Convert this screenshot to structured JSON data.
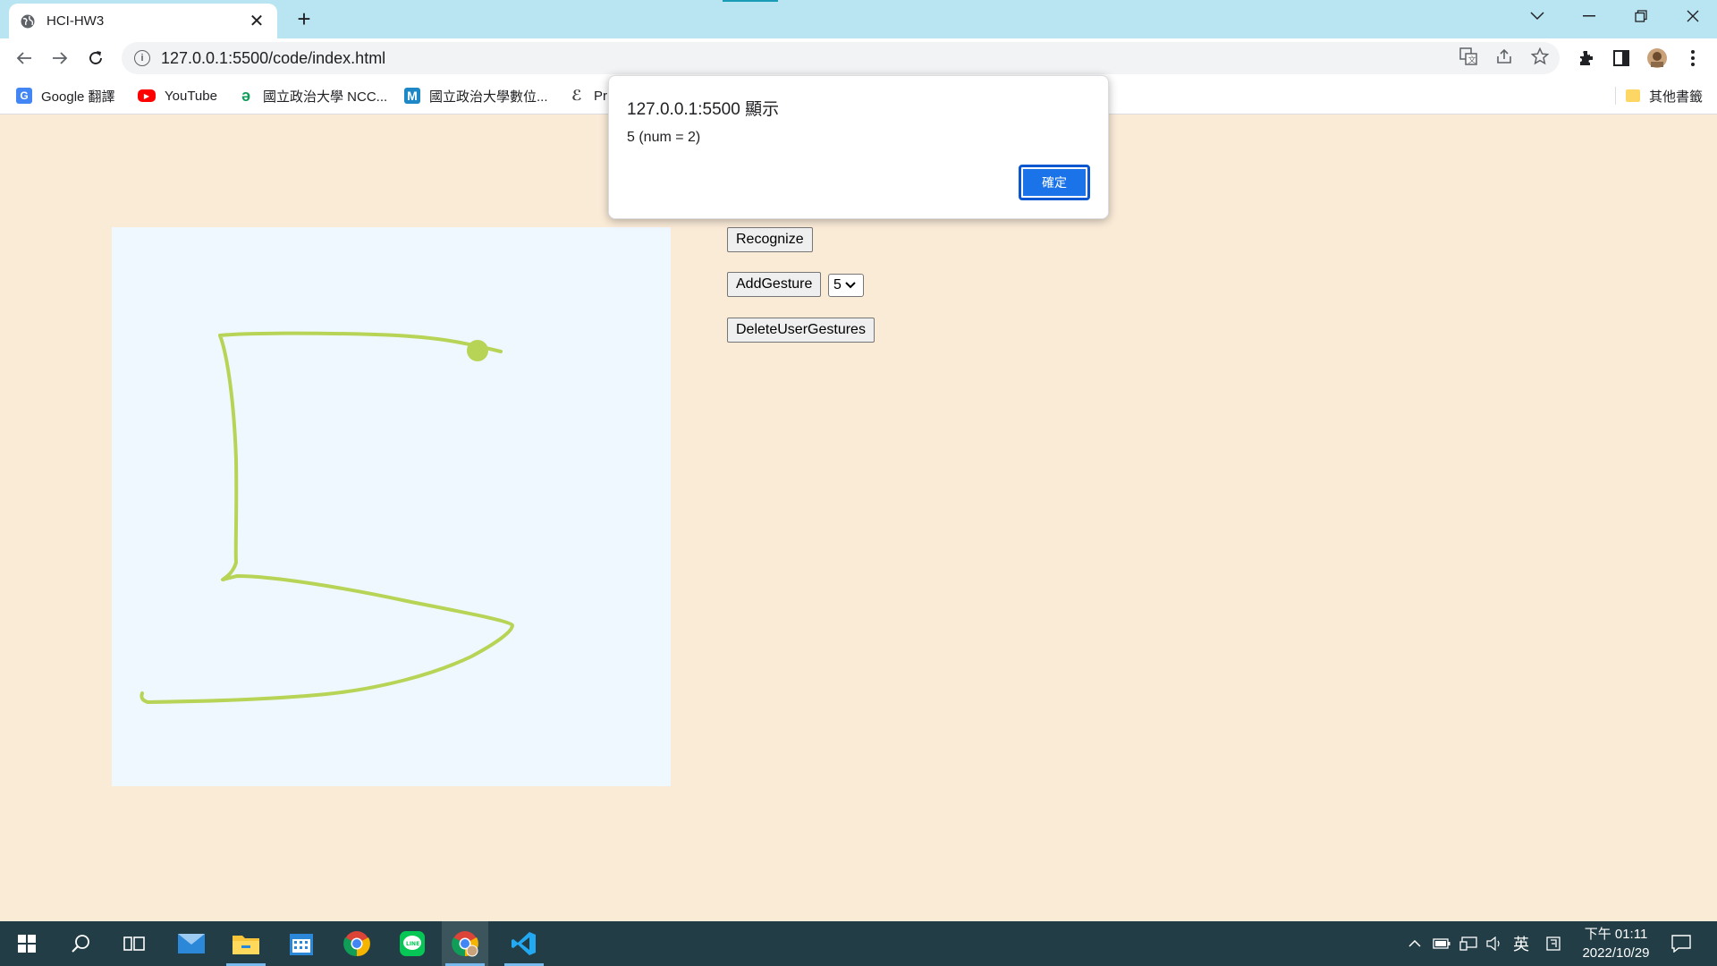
{
  "browser": {
    "tab_title": "HCI-HW3",
    "tab_close": "✕",
    "new_tab": "+",
    "url": "127.0.0.1:5500/code/index.html",
    "window_controls": [
      "chevron-down-icon",
      "minimize-icon",
      "restore-icon",
      "close-icon"
    ]
  },
  "bookmarks": {
    "items": [
      {
        "label": "Google 翻譯",
        "icon": "google-translate-icon",
        "color": "#4285f4"
      },
      {
        "label": "YouTube",
        "icon": "youtube-icon",
        "color": "#ff0000"
      },
      {
        "label": "國立政治大學 NCC...",
        "icon": "nccu-icon",
        "color": "#0f9d58"
      },
      {
        "label": "國立政治大學數位...",
        "icon": "moodle-icon",
        "color": "#1e88c7"
      },
      {
        "label": "Pr",
        "icon": "prism-icon",
        "color": "#444444"
      }
    ],
    "other": "其他書籤"
  },
  "page": {
    "recognize_label": "Recognize",
    "add_gesture_label": "AddGesture",
    "gesture_select_value": "5",
    "delete_label": "DeleteUserGestures",
    "canvas_bg": "#f0f8ff",
    "stroke_color": "#b8d456"
  },
  "dialog": {
    "title": "127.0.0.1:5500 顯示",
    "message": "5 (num = 2)",
    "ok_label": "確定"
  },
  "taskbar": {
    "apps": [
      "windows-start-icon",
      "search-icon",
      "task-view-icon",
      "mail-icon",
      "file-explorer-icon",
      "calendar-icon",
      "chrome-icon",
      "line-icon",
      "chrome-profile-icon",
      "vscode-icon"
    ],
    "ime": "英",
    "time": "下午 01:11",
    "date": "2022/10/29"
  }
}
